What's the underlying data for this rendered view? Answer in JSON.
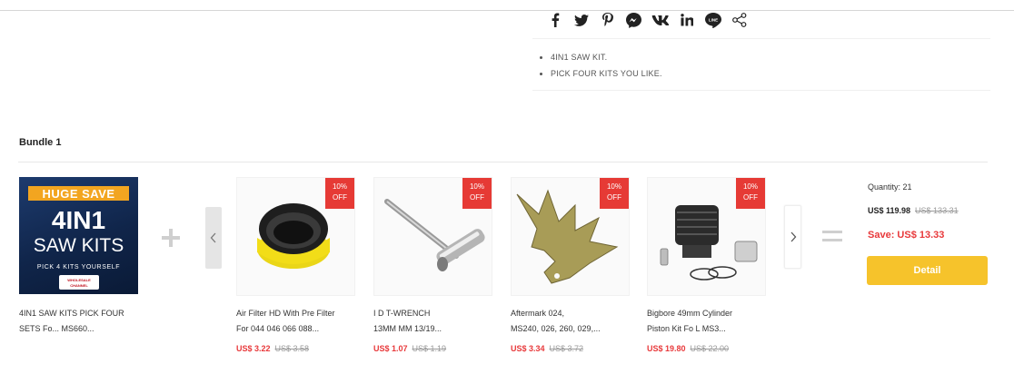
{
  "share": {
    "icons": [
      "facebook-icon",
      "twitter-icon",
      "pinterest-icon",
      "messenger-icon",
      "vk-icon",
      "linkedin-icon",
      "line-icon",
      "share-icon"
    ]
  },
  "description": {
    "bullets": [
      "4IN1 SAW KIT.",
      "PICK FOUR KITS YOU LIKE."
    ]
  },
  "bundle": {
    "title": "Bundle 1",
    "main": {
      "image": {
        "line1": "HUGE SAVE",
        "line2": "4IN1",
        "line3": "SAW KITS",
        "line4": "PICK 4 KITS YOURSELF",
        "logo_line1": "WHOLESALE",
        "logo_line2": "CHANNEL"
      },
      "name_line1": "4IN1 SAW KITS PICK FOUR",
      "name_line2": "SETS Fo...    MS660..."
    },
    "items": [
      {
        "badge_line1": "10%",
        "badge_line2": "OFF",
        "name_line1": "Air Filter HD With Pre Filter",
        "name_line2": "For    044 046 066 088...",
        "price": "US$ 3.22",
        "old_price": "US$ 3.58"
      },
      {
        "badge_line1": "10%",
        "badge_line2": "OFF",
        "name_line1": "I          D T-WRENCH",
        "name_line2": "13MM    MM 13/19...",
        "price": "US$ 1.07",
        "old_price": "US$ 1.19"
      },
      {
        "badge_line1": "10%",
        "badge_line2": "OFF",
        "name_line1": "Aftermark       024,",
        "name_line2": "MS240, 026,     260, 029,...",
        "price": "US$ 3.34",
        "old_price": "US$ 3.72"
      },
      {
        "badge_line1": "10%",
        "badge_line2": "OFF",
        "name_line1": "Bigbore 49mm Cylinder",
        "name_line2": "Piston Kit Fo       L MS3...",
        "price": "US$ 19.80",
        "old_price": "US$ 22.00"
      }
    ],
    "summary": {
      "quantity": "Quantity: 21",
      "total": "US$ 119.98",
      "total_old": "US$ 133.31",
      "save": "Save: US$ 13.33",
      "detail_label": "Detail"
    }
  },
  "colors": {
    "accent_red": "#e8393b",
    "badge_red": "#e63a35",
    "button_yellow": "#f6c32b",
    "main_image_blue": "#1d3b6e",
    "main_image_orange": "#f2a520"
  }
}
